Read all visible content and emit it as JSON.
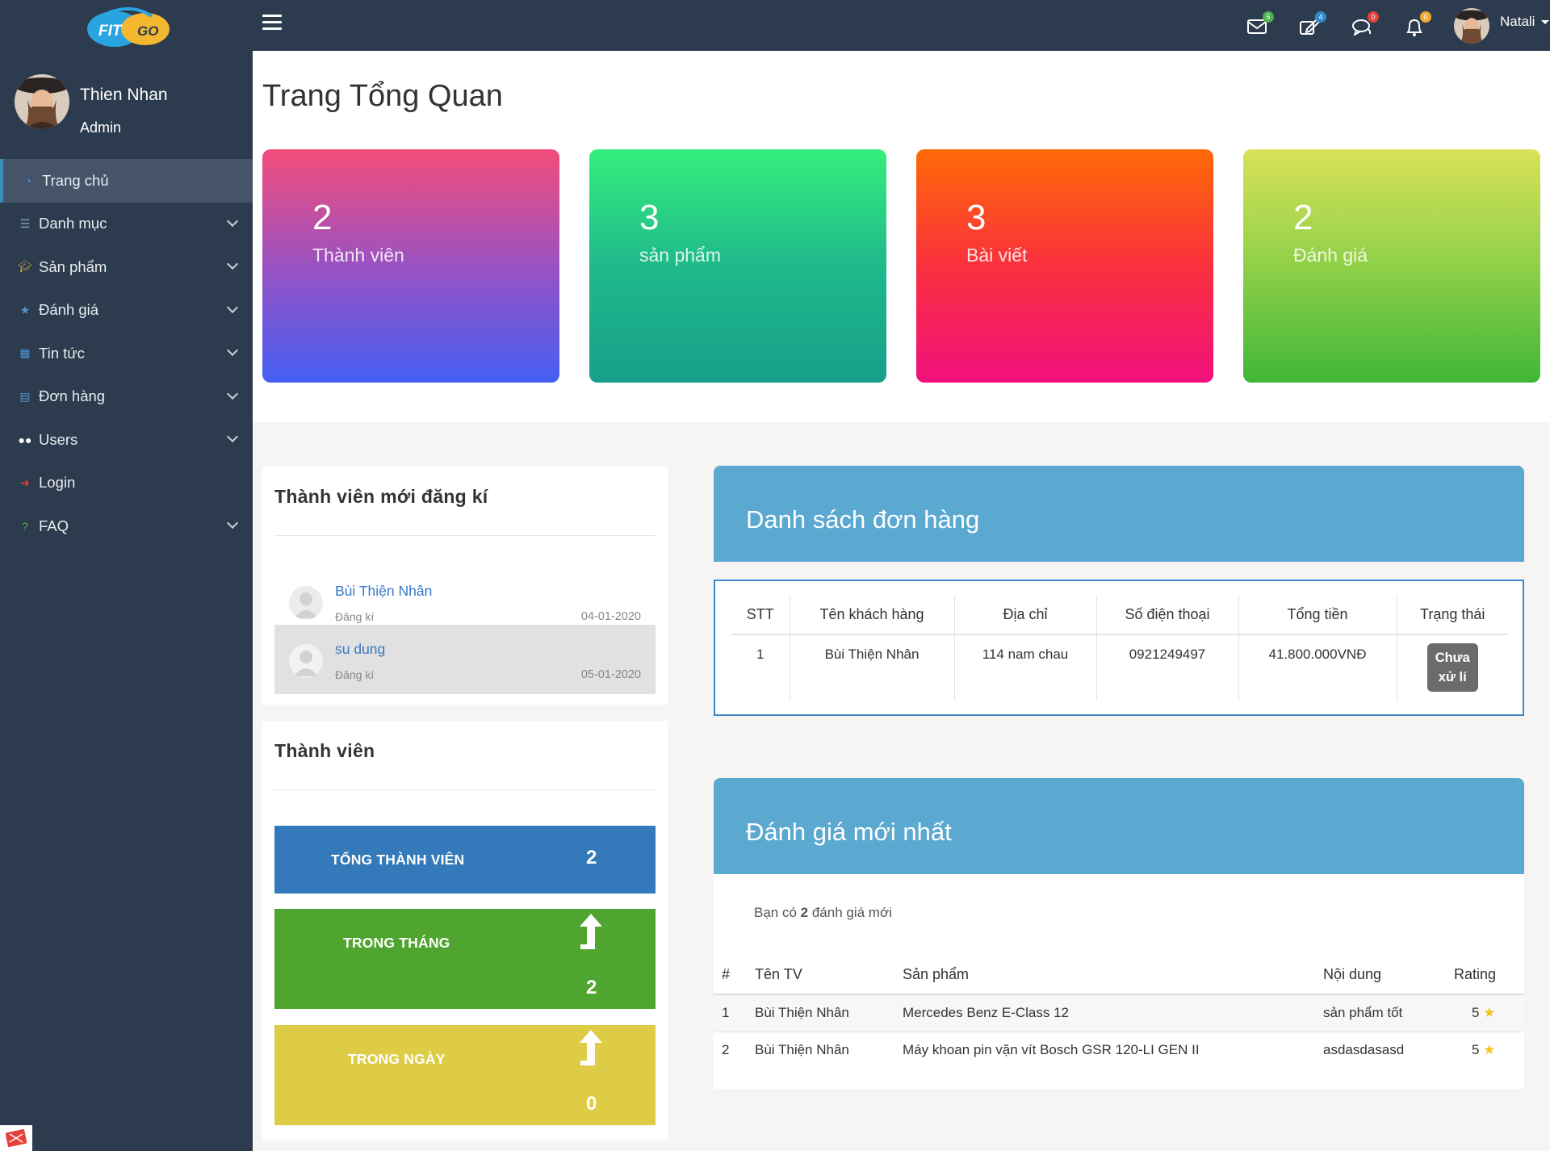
{
  "brand": {
    "logo_text_1": "FIT",
    "logo_text_2": "GO"
  },
  "sidebar": {
    "user_name": "Thien Nhan",
    "user_role": "Admin",
    "items": [
      {
        "label": "Trang chủ",
        "icon": "dashboard-icon",
        "active": true,
        "expandable": false
      },
      {
        "label": "Danh mục",
        "icon": "list-icon",
        "expandable": true
      },
      {
        "label": "Sản phẩm",
        "icon": "graduation-cap-icon",
        "expandable": true
      },
      {
        "label": "Đánh giá",
        "icon": "star-icon",
        "expandable": true
      },
      {
        "label": "Tin tức",
        "icon": "calendar-icon",
        "expandable": true
      },
      {
        "label": "Đơn hàng",
        "icon": "newspaper-icon",
        "expandable": true
      },
      {
        "label": "Users",
        "icon": "users-icon",
        "expandable": true
      },
      {
        "label": "Login",
        "icon": "sign-in-icon",
        "expandable": false
      },
      {
        "label": "FAQ",
        "icon": "question-icon",
        "expandable": true
      }
    ]
  },
  "topbar": {
    "badges": {
      "mail": "5",
      "edit": "4",
      "chat": "0",
      "bell": "0"
    },
    "badge_colors": {
      "mail": "#4caf50",
      "edit": "#2f89c9",
      "chat": "#e5413a",
      "bell": "#f0a92f"
    },
    "user_name": "Natali"
  },
  "page_title": "Trang Tổng Quan",
  "cards": [
    {
      "value": "2",
      "label": "Thành viên"
    },
    {
      "value": "3",
      "label": "sản phẩm"
    },
    {
      "value": "3",
      "label": "Bài viết"
    },
    {
      "value": "2",
      "label": "Đánh giá"
    }
  ],
  "new_members": {
    "title": "Thành viên mới đăng kí",
    "items": [
      {
        "name": "Bùi Thiện Nhân",
        "action": "Đăng kí",
        "date": "04-01-2020"
      },
      {
        "name": "su dung",
        "action": "Đăng kí",
        "date": "05-01-2020"
      }
    ]
  },
  "members": {
    "title": "Thành viên",
    "total_label": "TỔNG THÀNH VIÊN",
    "total_value": "2",
    "month_label": "TRONG THÁNG",
    "month_value": "2",
    "day_label": "TRONG NGÀY",
    "day_value": "0"
  },
  "orders": {
    "title": "Danh sách đơn hàng",
    "headers": [
      "STT",
      "Tên khách hàng",
      "Địa chỉ",
      "Số điện thoại",
      "Tổng tiền",
      "Trạng thái"
    ],
    "rows": [
      {
        "stt": "1",
        "customer": "Bùi Thiện Nhân",
        "address": "114 nam chau",
        "phone": "0921249497",
        "total": "41.800.000VNĐ",
        "status_line1": "Chưa",
        "status_line2": "xử lí"
      }
    ]
  },
  "reviews": {
    "title": "Đánh giá mới nhất",
    "note_prefix": "Bạn có ",
    "note_count": "2",
    "note_suffix": " đánh giá mới",
    "headers": [
      "#",
      "Tên TV",
      "Sản phẩm",
      "Nội dung",
      "Rating"
    ],
    "rows": [
      {
        "no": "1",
        "member": "Bùi Thiện Nhân",
        "product": "Mercedes Benz E-Class 12",
        "content": "sản phẩm tốt",
        "rating": "5"
      },
      {
        "no": "2",
        "member": "Bùi Thiện Nhân",
        "product": "Máy khoan pin vặn vít Bosch GSR 120-LI GEN II",
        "content": "asdasdasasd",
        "rating": "5"
      }
    ]
  }
}
